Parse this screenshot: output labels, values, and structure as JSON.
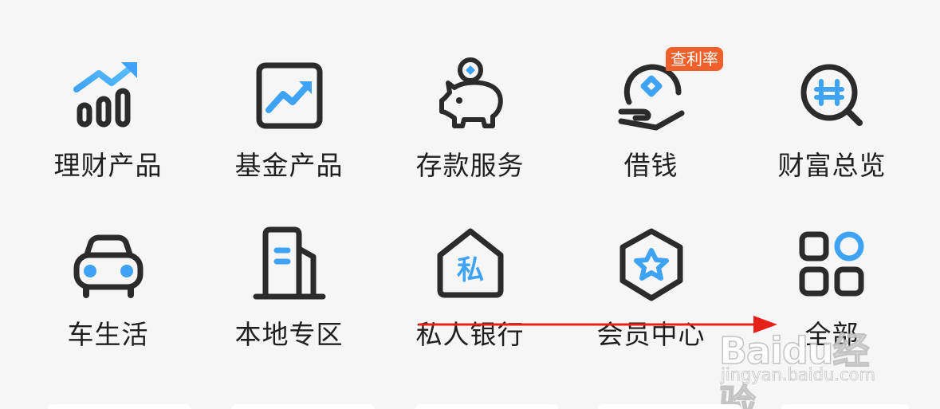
{
  "menu": {
    "items": [
      {
        "label": "理财产品",
        "icon": "trend-chart-icon"
      },
      {
        "label": "基金产品",
        "icon": "fund-chart-icon"
      },
      {
        "label": "存款服务",
        "icon": "piggy-bank-icon"
      },
      {
        "label": "借钱",
        "icon": "loan-hand-icon",
        "badge": "查利率"
      },
      {
        "label": "财富总览",
        "icon": "wealth-search-icon"
      },
      {
        "label": "车生活",
        "icon": "car-icon"
      },
      {
        "label": "本地专区",
        "icon": "building-icon"
      },
      {
        "label": "私人银行",
        "icon": "private-bank-icon",
        "icon_text": "私"
      },
      {
        "label": "会员中心",
        "icon": "member-star-icon"
      },
      {
        "label": "全部",
        "icon": "all-apps-icon"
      }
    ]
  },
  "colors": {
    "icon_dark": "#2b2b2b",
    "icon_blue": "#3fa3f5",
    "badge": "#f0602a",
    "background": "#f6f6f6",
    "annotation": "#e8201a"
  },
  "watermark": {
    "logo": "Baidu经验",
    "url": "jingyan.baidu.com"
  }
}
